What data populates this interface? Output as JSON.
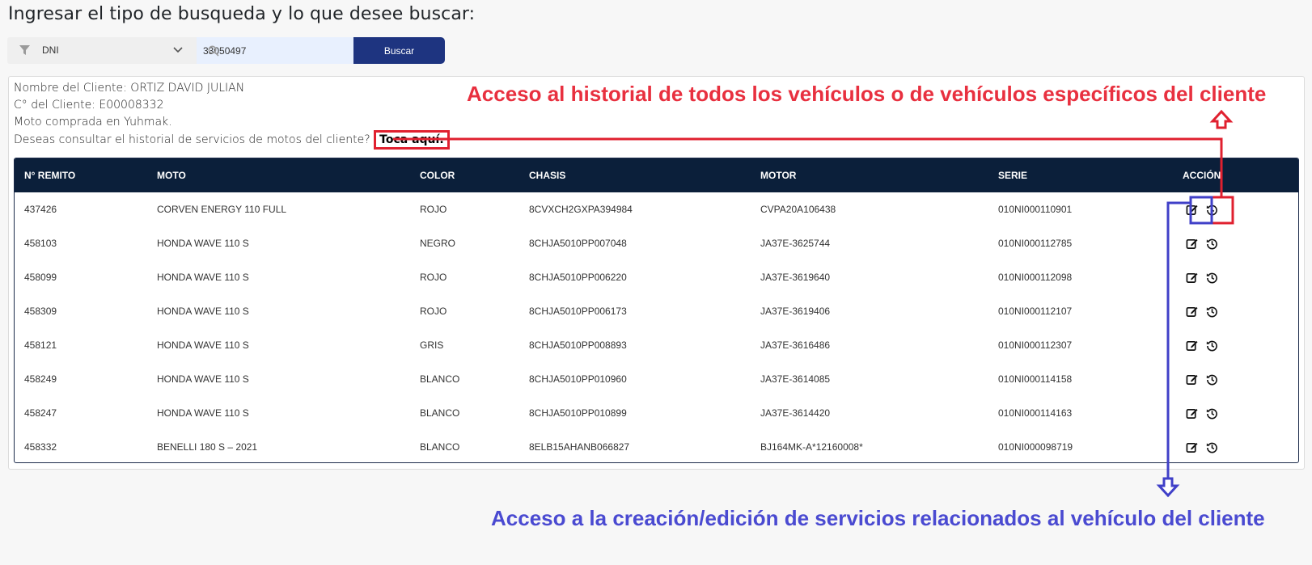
{
  "page_title": "Ingresar el tipo de busqueda y lo que desee buscar:",
  "search": {
    "filter_value": "DNI",
    "input_value": "33050497",
    "button_label": "Buscar"
  },
  "client": {
    "name_line": "Nombre del Cliente: ORTIZ DAVID JULIAN",
    "code_line": "C° del Cliente: E00008332",
    "purchase_line": "Moto comprada en Yuhmak.",
    "history_prompt": "Deseas consultar el historial de servicios de motos del cliente?",
    "history_link": "Toca aquí."
  },
  "table": {
    "columns": [
      "N° REMITO",
      "MOTO",
      "COLOR",
      "CHASIS",
      "MOTOR",
      "SERIE",
      "ACCIÓN"
    ],
    "rows": [
      [
        "437426",
        "CORVEN ENERGY 110 FULL",
        "ROJO",
        "8CVXCH2GXPA394984",
        "CVPA20A106438",
        "010NI000110901"
      ],
      [
        "458103",
        "HONDA WAVE 110 S",
        "NEGRO",
        "8CHJA5010PP007048",
        "JA37E-3625744",
        "010NI000112785"
      ],
      [
        "458099",
        "HONDA WAVE 110 S",
        "ROJO",
        "8CHJA5010PP006220",
        "JA37E-3619640",
        "010NI000112098"
      ],
      [
        "458309",
        "HONDA WAVE 110 S",
        "ROJO",
        "8CHJA5010PP006173",
        "JA37E-3619406",
        "010NI000112107"
      ],
      [
        "458121",
        "HONDA WAVE 110 S",
        "GRIS",
        "8CHJA5010PP008893",
        "JA37E-3616486",
        "010NI000112307"
      ],
      [
        "458249",
        "HONDA WAVE 110 S",
        "BLANCO",
        "8CHJA5010PP010960",
        "JA37E-3614085",
        "010NI000114158"
      ],
      [
        "458247",
        "HONDA WAVE 110 S",
        "BLANCO",
        "8CHJA5010PP010899",
        "JA37E-3614420",
        "010NI000114163"
      ],
      [
        "458332",
        "BENELLI 180 S – 2021",
        "BLANCO",
        "8ELB15AHANB066827",
        "BJ164MK-A*12160008*",
        "010NI000098719"
      ]
    ],
    "action_icons": [
      "edit-icon",
      "history-icon"
    ]
  },
  "annotations": {
    "history": "Acceso al historial de todos los vehículos o de vehículos específicos del cliente",
    "edit": "Acceso a la creación/edición de servicios relacionados al vehículo del cliente"
  },
  "colors": {
    "header_bg": "#0b1f3a",
    "button_bg": "#1e3480",
    "annotation_red": "#e8303f",
    "annotation_blue": "#4a4ad1"
  }
}
